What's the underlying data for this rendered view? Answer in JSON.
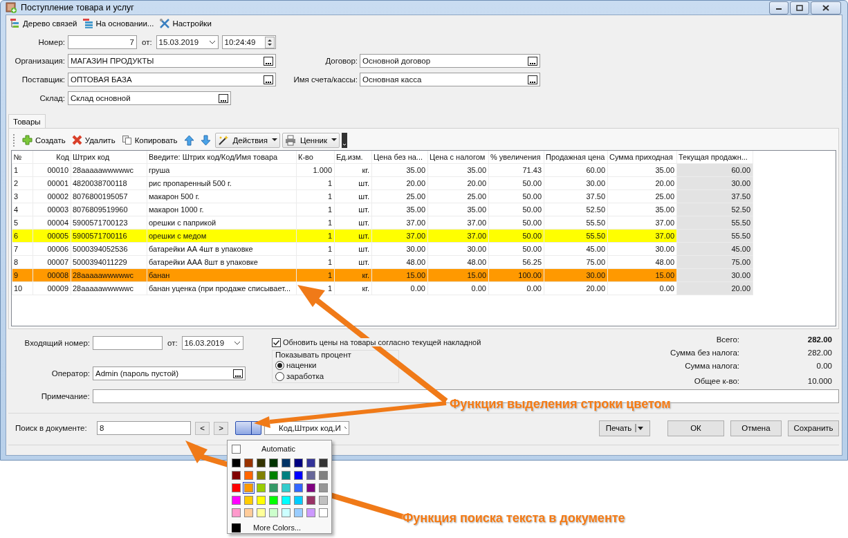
{
  "window": {
    "title": "Поступление товара и услуг"
  },
  "toolbar": [
    {
      "kind": "tree",
      "label": "Дерево связей"
    },
    {
      "kind": "stack",
      "label": "На основании..."
    },
    {
      "kind": "tools",
      "label": "Настройки"
    }
  ],
  "header": {
    "number": {
      "label": "Номер:",
      "value": "7"
    },
    "date": {
      "label": "от:",
      "value": "15.03.2019"
    },
    "time": {
      "value": "10:24:49"
    },
    "organization": {
      "label": "Организация:",
      "value": "МАГАЗИН ПРОДУКТЫ"
    },
    "contract": {
      "label": "Договор:",
      "value": "Основной договор"
    },
    "supplier": {
      "label": "Поставщик:",
      "value": "ОПТОВАЯ БАЗА"
    },
    "account": {
      "label": "Имя счета/кассы:",
      "value": "Основная касса"
    },
    "warehouse": {
      "label": "Склад:",
      "value": "Склад основной"
    }
  },
  "tabs": [
    {
      "label": "Товары",
      "selected": true
    }
  ],
  "grid_toolbar": [
    {
      "kind": "add",
      "label": "Создать"
    },
    {
      "kind": "delete",
      "label": "Удалить"
    },
    {
      "kind": "copy",
      "label": "Копировать"
    },
    {
      "kind": "up"
    },
    {
      "kind": "down"
    },
    {
      "kind": "wand-menu",
      "label": "Действия"
    },
    {
      "kind": "printer-menu",
      "label": "Ценник"
    }
  ],
  "table": {
    "columns": [
      "№",
      "Код",
      "Штрих код",
      "Введите: Штрих код/Код/Имя товара",
      "К-во",
      "Ед.изм.",
      "Цена без на...",
      "Цена с налогом",
      "% увеличения",
      "Продажная цена",
      "Сумма приходная",
      "Текущая продажн..."
    ],
    "rows": [
      {
        "cells": [
          "1",
          "00010",
          "28aaaaawwwwwc",
          "груша",
          "1.000",
          "кг.",
          "35.00",
          "35.00",
          "71.43",
          "60.00",
          "35.00",
          "60.00"
        ]
      },
      {
        "cells": [
          "2",
          "00001",
          "4820038700118",
          "рис пропаренный 500 г.",
          "1",
          "шт.",
          "20.00",
          "20.00",
          "50.00",
          "30.00",
          "20.00",
          "30.00"
        ]
      },
      {
        "cells": [
          "3",
          "00002",
          "8076800195057",
          "макарон 500 г.",
          "1",
          "шт.",
          "25.00",
          "25.00",
          "50.00",
          "37.50",
          "25.00",
          "37.50"
        ]
      },
      {
        "cells": [
          "4",
          "00003",
          "8076809519960",
          "макарон 1000 г.",
          "1",
          "шт.",
          "35.00",
          "35.00",
          "50.00",
          "52.50",
          "35.00",
          "52.50"
        ]
      },
      {
        "cells": [
          "5",
          "00004",
          "5900571700123",
          "орешки с паприкой",
          "1",
          "шт.",
          "37.00",
          "37.00",
          "50.00",
          "55.50",
          "37.00",
          "55.50"
        ]
      },
      {
        "cells": [
          "6",
          "00005",
          "5900571700116",
          "орешки с медом",
          "1",
          "шт.",
          "37.00",
          "37.00",
          "50.00",
          "55.50",
          "37.00",
          "55.50"
        ],
        "color": "#ffff00"
      },
      {
        "cells": [
          "7",
          "00006",
          "5000394052536",
          "батарейки АА 4шт в упаковке",
          "1",
          "шт.",
          "30.00",
          "30.00",
          "50.00",
          "45.00",
          "30.00",
          "45.00"
        ]
      },
      {
        "cells": [
          "8",
          "00007",
          "5000394011229",
          "батарейки ААА 8шт в упаковке",
          "1",
          "шт.",
          "48.00",
          "48.00",
          "56.25",
          "75.00",
          "48.00",
          "75.00"
        ]
      },
      {
        "cells": [
          "9",
          "00008",
          "28aaaaawwwwwc",
          "банан",
          "1",
          "кг.",
          "15.00",
          "15.00",
          "100.00",
          "30.00",
          "15.00",
          "30.00"
        ],
        "color": "#ff9900"
      },
      {
        "cells": [
          "10",
          "00009",
          "28aaaaawwwwwc",
          "банан уценка (при продаже списывает...",
          "1",
          "кг.",
          "0.00",
          "0.00",
          "0.00",
          "20.00",
          "0.00",
          "20.00"
        ]
      }
    ]
  },
  "footer": {
    "incoming": {
      "label": "Входящий номер:"
    },
    "incoming_date": {
      "label": "от:",
      "value": "16.03.2019"
    },
    "update_prices": {
      "label": "Обновить цены на товары согласно текущей накладной",
      "checked": true
    },
    "percent_group": {
      "title": "Показывать процент",
      "options": [
        {
          "label": "наценки",
          "selected": true
        },
        {
          "label": "заработка",
          "selected": false
        }
      ]
    },
    "operator": {
      "label": "Оператор:",
      "value": "Admin (пароль пустой)"
    },
    "note": {
      "label": "Примечание:"
    },
    "totals": [
      {
        "label": "Всего:",
        "value": "282.00",
        "emphasis": true
      },
      {
        "label": "Сумма без налога:",
        "value": "282.00",
        "emphasis": false
      },
      {
        "label": "Сумма налога:",
        "value": "0.00",
        "emphasis": false
      },
      {
        "label": "Общее к-во:",
        "value": "10.000",
        "emphasis": false
      }
    ]
  },
  "search": {
    "label": "Поиск в документе:",
    "value": "8",
    "prev": "<",
    "next": ">",
    "columns_combo": "Код,Штрих код,И"
  },
  "buttons": [
    {
      "kind": "split",
      "label": "Печать"
    },
    {
      "kind": "plain",
      "label": "ОК"
    },
    {
      "kind": "plain",
      "label": "Отмена"
    },
    {
      "kind": "plain",
      "label": "Сохранить"
    }
  ],
  "color_picker": {
    "automatic": "Automatic",
    "more": "More Colors...",
    "swatches": [
      {
        "color": "#000000",
        "selected": false
      },
      {
        "color": "#993300",
        "selected": false
      },
      {
        "color": "#333300",
        "selected": false
      },
      {
        "color": "#003300",
        "selected": false
      },
      {
        "color": "#003366",
        "selected": false
      },
      {
        "color": "#000080",
        "selected": false
      },
      {
        "color": "#333399",
        "selected": false
      },
      {
        "color": "#333333",
        "selected": false
      },
      {
        "color": "#800000",
        "selected": false
      },
      {
        "color": "#ff6600",
        "selected": false
      },
      {
        "color": "#808000",
        "selected": false
      },
      {
        "color": "#008000",
        "selected": false
      },
      {
        "color": "#008080",
        "selected": false
      },
      {
        "color": "#0000ff",
        "selected": false
      },
      {
        "color": "#666699",
        "selected": false
      },
      {
        "color": "#808080",
        "selected": false
      },
      {
        "color": "#ff0000",
        "selected": false
      },
      {
        "color": "#ff9900",
        "selected": true
      },
      {
        "color": "#99cc00",
        "selected": false
      },
      {
        "color": "#339966",
        "selected": false
      },
      {
        "color": "#33cccc",
        "selected": false
      },
      {
        "color": "#3366ff",
        "selected": false
      },
      {
        "color": "#800080",
        "selected": false
      },
      {
        "color": "#969696",
        "selected": false
      },
      {
        "color": "#ff00ff",
        "selected": false
      },
      {
        "color": "#ffcc00",
        "selected": false
      },
      {
        "color": "#ffff00",
        "selected": false
      },
      {
        "color": "#00ff00",
        "selected": false
      },
      {
        "color": "#00ffff",
        "selected": false
      },
      {
        "color": "#00ccff",
        "selected": false
      },
      {
        "color": "#993366",
        "selected": false
      },
      {
        "color": "#c0c0c0",
        "selected": false
      },
      {
        "color": "#ff99cc",
        "selected": false
      },
      {
        "color": "#ffcc99",
        "selected": false
      },
      {
        "color": "#ffff99",
        "selected": false
      },
      {
        "color": "#ccffcc",
        "selected": false
      },
      {
        "color": "#ccffff",
        "selected": false
      },
      {
        "color": "#99ccff",
        "selected": false
      },
      {
        "color": "#cc99ff",
        "selected": false
      },
      {
        "color": "#ffffff",
        "selected": false
      }
    ]
  },
  "annotations": [
    {
      "text": "Функция выделения строки цветом"
    },
    {
      "text": "Функция поиска текста в документе"
    }
  ]
}
